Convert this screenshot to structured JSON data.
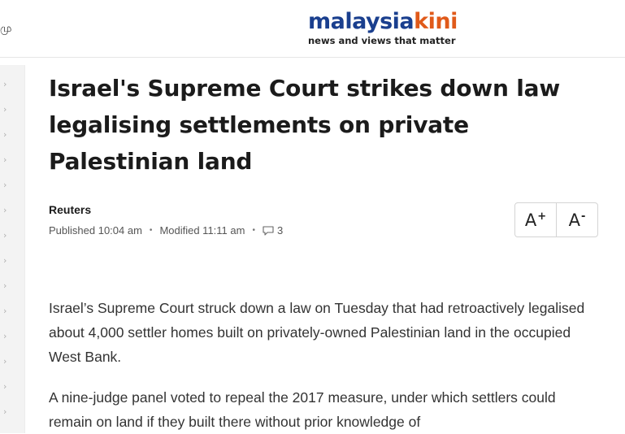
{
  "header": {
    "left_glyph": "மு",
    "logo": {
      "part1": "malaysia",
      "part2": "kini",
      "tagline": "news and views that matter"
    }
  },
  "article": {
    "title": "Israel's Supreme Court strikes down law legalising settlements on private Palestinian land",
    "author": "Reuters",
    "published": "Published 10:04 am",
    "modified": "Modified 11:11 am",
    "comment_count": "3",
    "font_increase_label": "A",
    "font_increase_sup": "+",
    "font_decrease_label": "A",
    "font_decrease_sup": "-",
    "paragraphs": [
      "Israel’s Supreme Court struck down a law on Tuesday that had retroactively legalised about 4,000 settler homes built on privately-owned Palestinian land in the occupied West Bank.",
      "A nine-judge panel voted to repeal the 2017 measure, under which settlers could remain on land if they built there without prior knowledge of"
    ]
  },
  "sidebar": {
    "chevron": "›"
  },
  "colors": {
    "logo_primary": "#1a3f8e",
    "logo_accent": "#e05a1a",
    "sidebar_bg": "#f3f3f3"
  }
}
